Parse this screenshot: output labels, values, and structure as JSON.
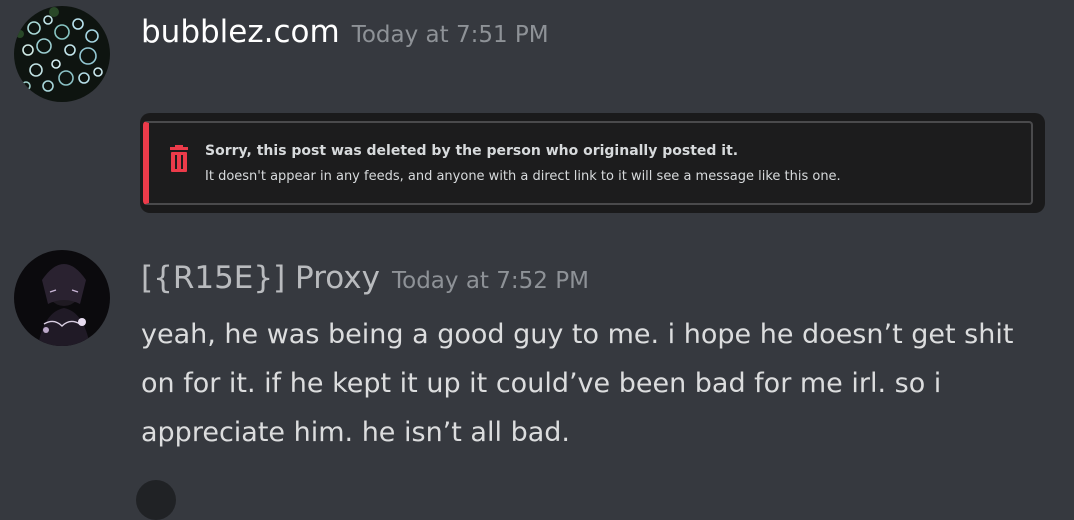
{
  "messages": [
    {
      "username": "bubblez.com",
      "timestamp": "Today at 7:51 PM",
      "avatar_icon": "bubbles-avatar",
      "embed": {
        "title": "Sorry, this post was deleted by the person who originally posted it.",
        "subtitle": "It doesn't appear in any feeds, and anyone with a direct link to it will see a message like this one.",
        "icon": "trash-icon",
        "accent_color": "#ec3b4a"
      }
    },
    {
      "username": "[{R15E}] Proxy",
      "timestamp": "Today at 7:52 PM",
      "avatar_icon": "anime-character-avatar",
      "text": "yeah, he was being a good guy to me. i hope he doesn’t get shit on for it. if he kept it up it could’ve been bad for me irl. so i appreciate him. he isn’t all bad."
    }
  ],
  "colors": {
    "background": "#36393f",
    "username": "#ffffff",
    "timestamp": "#8e9297",
    "message_text": "#dcddde"
  }
}
